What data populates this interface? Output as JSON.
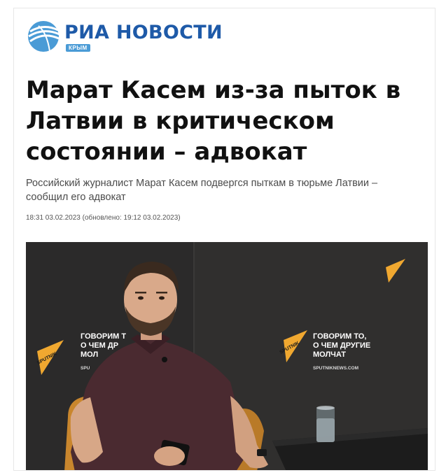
{
  "brand": {
    "name": "РИА НОВОСТИ",
    "region_badge": "КРЫМ",
    "color": "#1e5aa8",
    "badge_color": "#4a9bd6"
  },
  "article": {
    "headline": "Марат Касем из-за пыток в Латвии в критическом состоянии – адвокат",
    "subtitle": "Российский журналист Марат Касем подвергся пыткам в тюрьме Латвии – сообщил его адвокат",
    "meta": "18:31 03.02.2023 (обновлено: 19:12 03.02.2023)"
  },
  "photo": {
    "backdrop_text_line1": "ГОВОРИМ ТО,",
    "backdrop_text_line2": "О ЧЕМ ДРУГИЕ",
    "backdrop_text_line3": "МОЛЧАТ",
    "backdrop_url": "SPUTNIKNEWS.COM",
    "left_text_line1": "ГОВОРИМ Т",
    "left_text_line2": "О ЧЕМ ДР",
    "left_text_line3": "МОЛ",
    "left_url": "SPU",
    "logo_word": "SPUTNIK",
    "accent_color": "#f0a830",
    "wall_color": "#2b2a2a"
  }
}
